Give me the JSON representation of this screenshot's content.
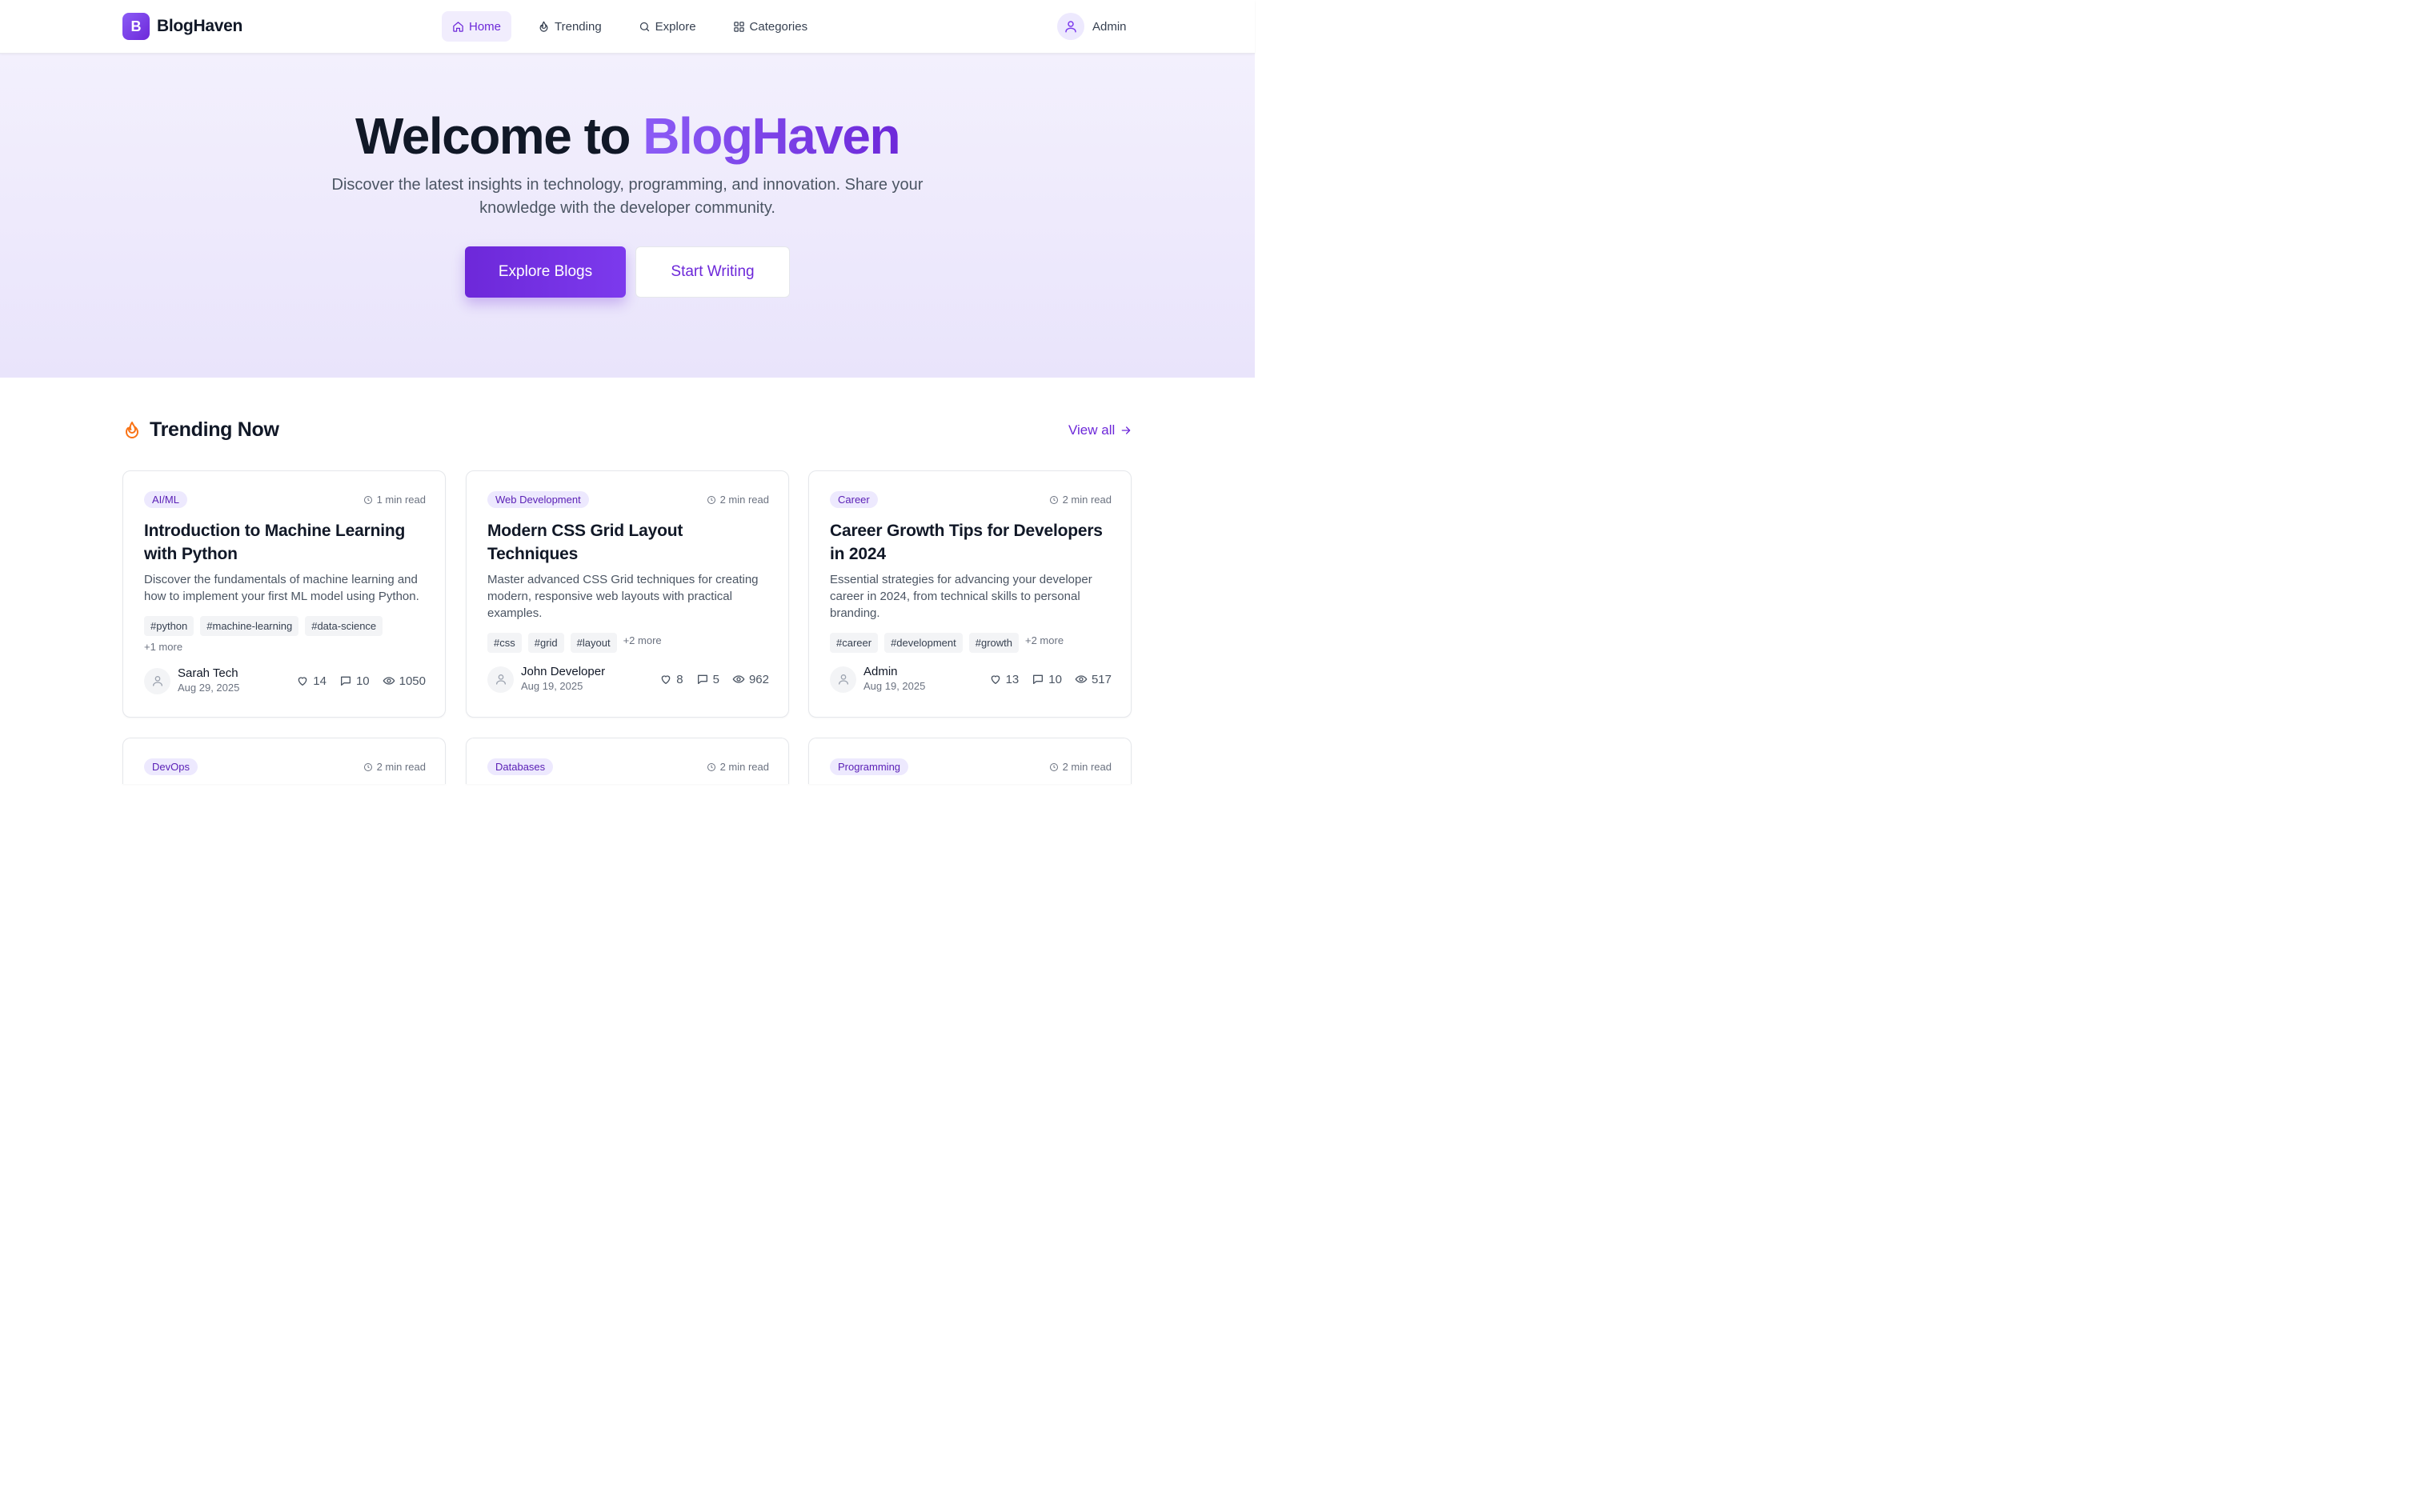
{
  "brand": {
    "initial": "B",
    "name": "BlogHaven"
  },
  "nav": [
    {
      "label": "Home",
      "icon": "home-icon",
      "active": true
    },
    {
      "label": "Trending",
      "icon": "flame-icon"
    },
    {
      "label": "Explore",
      "icon": "search-icon"
    },
    {
      "label": "Categories",
      "icon": "grid-icon"
    }
  ],
  "user": {
    "name": "Admin",
    "icon": "user-icon"
  },
  "hero": {
    "title_lead": "Welcome to",
    "title_accent": "BlogHaven",
    "subtitle": "Discover the latest insights in technology, programming, and innovation. Share your knowledge with the developer community.",
    "primary_button": "Explore Blogs",
    "secondary_button": "Start Writing"
  },
  "trending": {
    "title": "Trending Now",
    "icon": "flame-icon",
    "view_all": "View all"
  },
  "cards": [
    {
      "category": "AI/ML",
      "read_time": "1 min read",
      "title": "Introduction to Machine Learning with Python",
      "excerpt": "Discover the fundamentals of machine learning and how to implement your first ML model using Python.",
      "tags": [
        "#python",
        "#machine-learning",
        "#data-science"
      ],
      "more": "+1 more",
      "author": "Sarah Tech",
      "date": "Aug 29, 2025",
      "likes": "14",
      "comments": "10",
      "views": "1050"
    },
    {
      "category": "Web Development",
      "read_time": "2 min read",
      "title": "Modern CSS Grid Layout Techniques",
      "excerpt": "Master advanced CSS Grid techniques for creating modern, responsive web layouts with practical examples.",
      "tags": [
        "#css",
        "#grid",
        "#layout"
      ],
      "more": "+2 more",
      "author": "John Developer",
      "date": "Aug 19, 2025",
      "likes": "8",
      "comments": "5",
      "views": "962"
    },
    {
      "category": "Career",
      "read_time": "2 min read",
      "title": "Career Growth Tips for Developers in 2024",
      "excerpt": "Essential strategies for advancing your developer career in 2024, from technical skills to personal branding.",
      "tags": [
        "#career",
        "#development",
        "#growth"
      ],
      "more": "+2 more",
      "author": "Admin",
      "date": "Aug 19, 2025",
      "likes": "13",
      "comments": "10",
      "views": "517"
    },
    {
      "category": "DevOps",
      "read_time": "2 min read"
    },
    {
      "category": "Databases",
      "read_time": "2 min read"
    },
    {
      "category": "Programming",
      "read_time": "2 min read"
    }
  ],
  "colors": {
    "accent": "#6d28d9",
    "accent_light": "#ede9fe",
    "flame": "#f97316"
  }
}
